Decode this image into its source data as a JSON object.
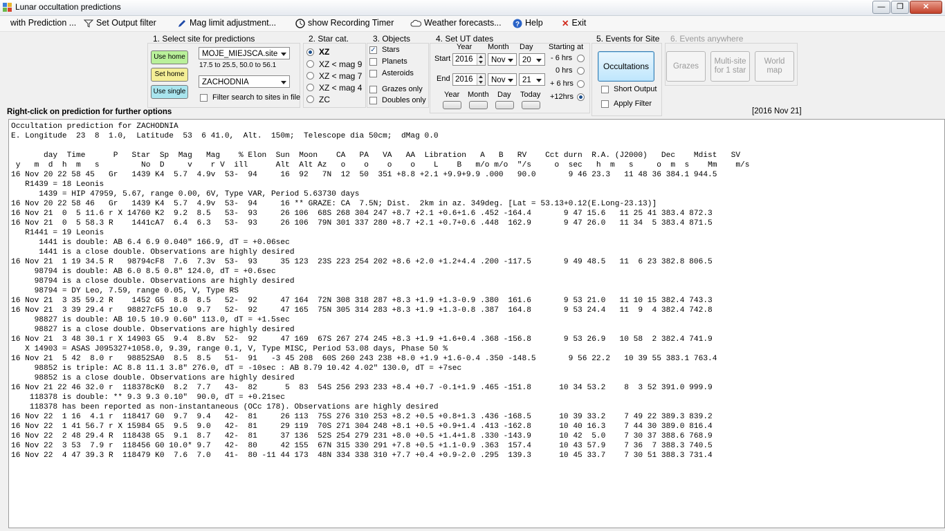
{
  "window": {
    "title": "Lunar occultation predictions"
  },
  "menu": [
    {
      "label": "with Prediction ..."
    },
    {
      "label": "Set Output filter",
      "icon": "funnel-icon"
    },
    {
      "label": "Mag limit adjustment...",
      "icon": "pen-icon"
    },
    {
      "label": "show Recording Timer",
      "icon": "clock-icon"
    },
    {
      "label": "Weather forecasts...",
      "icon": "cloud-icon"
    },
    {
      "label": "Help",
      "icon": "help-icon"
    },
    {
      "label": "Exit",
      "icon": "close-x-icon"
    }
  ],
  "site": {
    "heading": "1.  Select site for predictions",
    "use_home": "Use home",
    "set_home": "Set home",
    "use_single": "Use single",
    "file_combo": "MOJE_MIEJSCA.site",
    "range_text": "17.5 to 25.5, 50.0 to 56.1",
    "site_combo": "ZACHODNIA",
    "filter_label": "Filter search to sites in file"
  },
  "starcat": {
    "heading": "2. Star cat.",
    "options": [
      "XZ",
      "XZ  < mag 9",
      "XZ  < mag 7",
      "XZ  < mag 4",
      "ZC"
    ]
  },
  "objects": {
    "heading": "3. Objects",
    "items": [
      "Stars",
      "Planets",
      "Asteroids"
    ],
    "grazes_only": "Grazes only",
    "doubles_only": "Doubles only"
  },
  "dates": {
    "heading": "4.  Set UT dates",
    "col_year": "Year",
    "col_month": "Month",
    "col_day": "Day",
    "start_label": "Start",
    "end_label": "End",
    "start_year": "2016",
    "start_month": "Nov",
    "start_day": "20",
    "end_year": "2016",
    "end_month": "Nov",
    "end_day": "21",
    "starting_at": "Starting at",
    "offsets": [
      "- 6 hrs",
      "0 hrs",
      "+ 6 hrs",
      "+12hrs"
    ],
    "btn_year": "Year",
    "btn_month": "Month",
    "btn_day": "Day",
    "btn_today": "Today"
  },
  "events_site": {
    "heading": "5. Events for Site",
    "occultations": "Occultations",
    "short_output": "Short Output",
    "apply_filter": "Apply Filter"
  },
  "events_anywhere": {
    "heading": "6.  Events anywhere",
    "grazes": "Grazes",
    "multisite_1": "Multi-site",
    "multisite_2": "for 1 star",
    "world_1": "World",
    "world_2": "map"
  },
  "right_click_hint": "Right-click on prediction for further options",
  "date_stamp": "[2016 Nov 21]",
  "output_text": "Occultation prediction for ZACHODNIA\nE. Longitude  23  8  1.0,  Latitude  53  6 41.0,  Alt.  150m;  Telescope dia 50cm;  dMag 0.0\n\n       day  Time      P   Star  Sp  Mag   Mag    % Elon  Sun  Moon    CA   PA   VA   AA  Libration   A   B   RV    Cct durn  R.A. (J2000)   Dec    Mdist   SV\n y   m  d  h  m   s         No  D     v    r V  ill      Alt  Alt Az   o    o    o    o    L    B   m/o m/o  \"/s     o  sec   h  m   s     o  m  s    Mm    m/s\n16 Nov 20 22 58 45   Gr   1439 K4  5.7  4.9v  53-  94     16  92   7N  12  50  351 +8.8 +2.1 +9.9+9.9 .000   90.0       9 46 23.3   11 48 36 384.1 944.5\n   R1439 = 18 Leonis\n      1439 = HIP 47959, 5.67, range 0.00, 6V, Type VAR, Period 5.63730 days\n16 Nov 20 22 58 46   Gr   1439 K4  5.7  4.9v  53-  94     16 ** GRAZE: CA  7.5N; Dist.  2km in az. 349deg. [Lat = 53.13+0.12(E.Long-23.13)]\n16 Nov 21  0  5 11.6 r X 14760 K2  9.2  8.5   53-  93     26 106  68S 268 304 247 +8.7 +2.1 +0.6+1.6 .452 -164.4       9 47 15.6   11 25 41 383.4 872.3\n16 Nov 21  0  5 58.3 R    1441cA7  6.4  6.3   53-  93     26 106  79N 301 337 280 +8.7 +2.1 +0.7+0.6 .448  162.9       9 47 26.0   11 34  5 383.4 871.5\n   R1441 = 19 Leonis\n      1441 is double: AB 6.4 6.9 0.040\" 166.9, dT = +0.06sec\n      1441 is a close double. Observations are highly desired\n16 Nov 21  1 19 34.5 R   98794cF8  7.6  7.3v  53-  93     35 123  23S 223 254 202 +8.6 +2.0 +1.2+4.4 .200 -117.5       9 49 48.5   11  6 23 382.8 806.5\n     98794 is double: AB 6.0 8.5 0.8\" 124.0, dT = +0.6sec\n     98794 is a close double. Observations are highly desired\n     98794 = DY Leo, 7.59, range 0.05, V, Type RS\n16 Nov 21  3 35 59.2 R    1452 G5  8.8  8.5   52-  92     47 164  72N 308 318 287 +8.3 +1.9 +1.3-0.9 .380  161.6       9 53 21.0   11 10 15 382.4 743.3\n16 Nov 21  3 39 29.4 r   98827cF5 10.0  9.7   52-  92     47 165  75N 305 314 283 +8.3 +1.9 +1.3-0.8 .387  164.8       9 53 24.4   11  9  4 382.4 742.8\n     98827 is double: AB 10.5 10.9 0.60\" 113.0, dT = +1.5sec\n     98827 is a close double. Observations are highly desired\n16 Nov 21  3 48 30.1 r X 14903 G5  9.4  8.8v  52-  92     47 169  67S 267 274 245 +8.3 +1.9 +1.6+0.4 .368 -156.8       9 53 26.9   10 58  2 382.4 741.9\n   X 14903 = ASAS J095327+1058.0, 9.39, range 0.1, V, Type MISC, Period 53.08 days, Phase 50 %\n16 Nov 21  5 42  8.0 r   98852SA0  8.5  8.5   51-  91   -3 45 208  60S 260 243 238 +8.0 +1.9 +1.6-0.4 .350 -148.5       9 56 22.2   10 39 55 383.1 763.4\n     98852 is triple: AC 8.8 11.1 3.8\" 276.0, dT = -10sec : AB 8.79 10.42 4.02\" 130.0, dT = +7sec\n     98852 is a close double. Observations are highly desired\n16 Nov 21 22 46 32.0 r  118378cK0  8.2  7.7   43-  82      5  83  54S 256 293 233 +8.4 +0.7 -0.1+1.9 .465 -151.8      10 34 53.2    8  3 52 391.0 999.9\n    118378 is double: ** 9.3 9.3 0.10\"  90.0, dT = +0.21sec\n    118378 has been reported as non-instantaneous (OCc 178). Observations are highly desired\n16 Nov 22  1 16  4.1 r  118417 G0  9.7  9.4   42-  81     26 113  75S 276 310 253 +8.2 +0.5 +0.8+1.3 .436 -168.5      10 39 33.2    7 49 22 389.3 839.2\n16 Nov 22  1 41 56.7 r X 15984 G5  9.5  9.0   42-  81     29 119  70S 271 304 248 +8.1 +0.5 +0.9+1.4 .413 -162.8      10 40 16.3    7 44 30 389.0 816.4\n16 Nov 22  2 48 29.4 R  118438 G5  9.1  8.7   42-  81     37 136  52S 254 279 231 +8.0 +0.5 +1.4+1.8 .330 -143.9      10 42  5.0    7 30 37 388.6 768.9\n16 Nov 22  3 53  7.9 r  118456 G0 10.0* 9.7   42-  80     42 155  67N 315 330 291 +7.8 +0.5 +1.1-0.9 .363  157.4      10 43 57.9    7 36  7 388.3 740.5\n16 Nov 22  4 47 39.3 R  118479 K0  7.6  7.0   41-  80 -11 44 173  48N 334 338 310 +7.7 +0.4 +0.9-2.0 .295  139.3      10 45 33.7    7 30 51 388.3 731.4"
}
